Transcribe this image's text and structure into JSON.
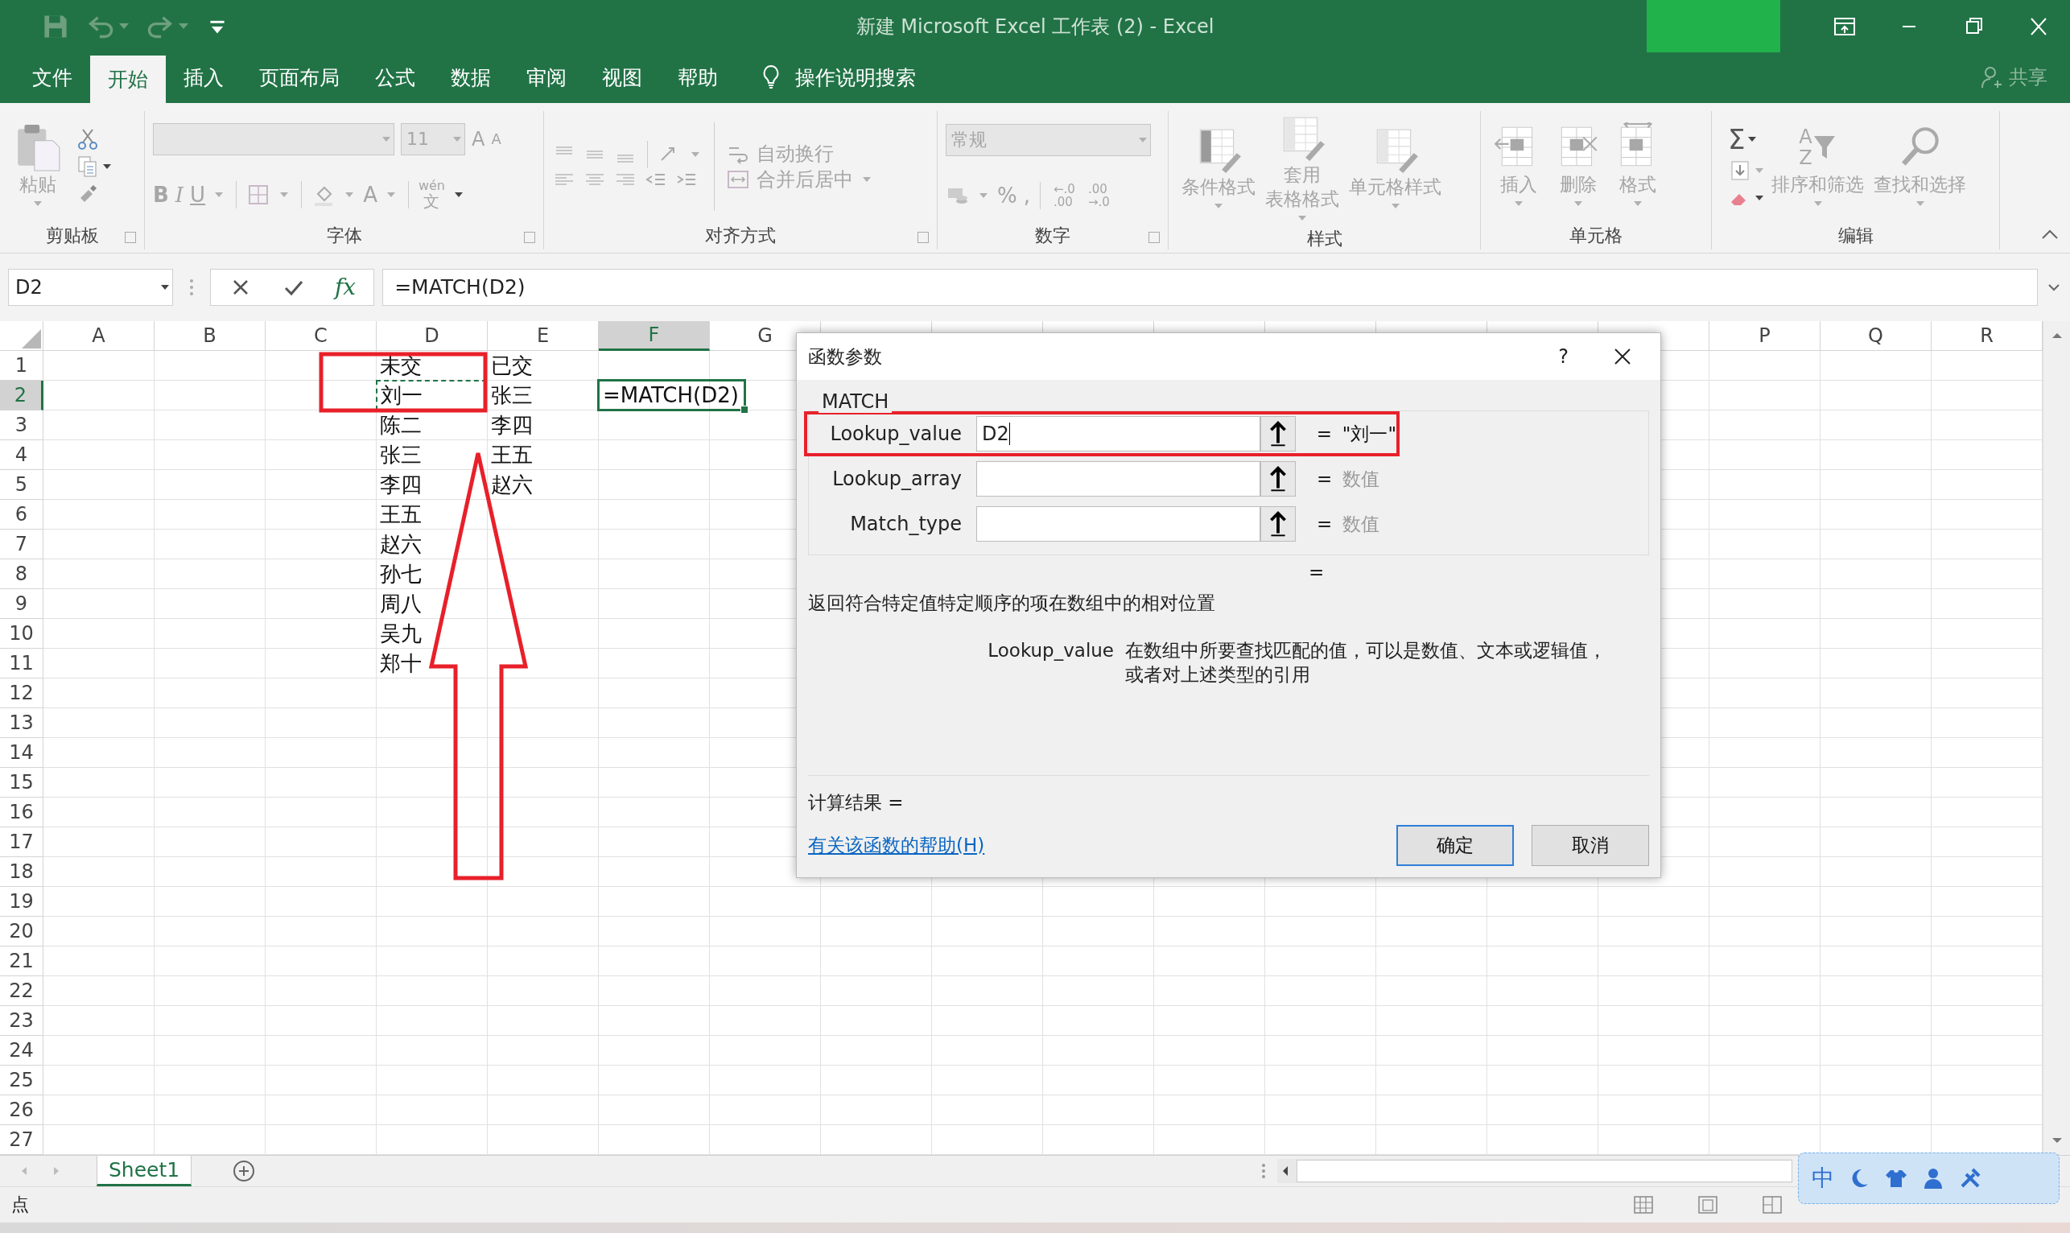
{
  "window": {
    "title": "新建 Microsoft Excel 工作表 (2)  -  Excel"
  },
  "ribbon_tabs": [
    {
      "label": "文件",
      "selected": false
    },
    {
      "label": "开始",
      "selected": true
    },
    {
      "label": "插入",
      "selected": false
    },
    {
      "label": "页面布局",
      "selected": false
    },
    {
      "label": "公式",
      "selected": false
    },
    {
      "label": "数据",
      "selected": false
    },
    {
      "label": "审阅",
      "selected": false
    },
    {
      "label": "视图",
      "selected": false
    },
    {
      "label": "帮助",
      "selected": false
    }
  ],
  "tell_me": "操作说明搜索",
  "share": "共享",
  "ribbon": {
    "disabled": true,
    "clipboard": {
      "label": "剪贴板",
      "paste": "粘贴"
    },
    "font": {
      "label": "字体",
      "size": "11",
      "grow": "A",
      "shrink": "A",
      "bold": "B",
      "italic": "I",
      "underline": "U",
      "font_color": "A",
      "phonetic_top": "wén",
      "phonetic_bottom": "文"
    },
    "alignment": {
      "label": "对齐方式",
      "wrap": "自动换行",
      "merge": "合并后居中"
    },
    "number": {
      "label": "数字",
      "format": "常规",
      "percent": "%",
      "comma": ",",
      "increase_decimal": [
        "←.0",
        ".00"
      ],
      "decrease_decimal": [
        ".00",
        "→.0"
      ]
    },
    "styles": {
      "label": "样式",
      "buttons": [
        {
          "lines": [
            "条件格式"
          ]
        },
        {
          "lines": [
            "套用",
            "表格格式"
          ]
        },
        {
          "lines": [
            "单元格样式"
          ]
        }
      ]
    },
    "cells": {
      "label": "单元格",
      "buttons": [
        "插入",
        "删除",
        "格式"
      ]
    },
    "editing": {
      "label": "编辑",
      "sum": "Σ",
      "sort_letters": [
        "A",
        "Z"
      ],
      "buttons": [
        "排序和筛选",
        "查找和选择"
      ]
    }
  },
  "formula_bar": {
    "name_box": "D2",
    "insert_function": "fx",
    "formula": "=MATCH(D2)"
  },
  "sheet": {
    "columns": [
      {
        "label": "A",
        "selected": false
      },
      {
        "label": "B",
        "selected": false
      },
      {
        "label": "C",
        "selected": false
      },
      {
        "label": "D",
        "selected": false
      },
      {
        "label": "E",
        "selected": false
      },
      {
        "label": "F",
        "selected": true
      },
      {
        "label": "G",
        "selected": false
      },
      null,
      null,
      null,
      null,
      null,
      null,
      null,
      null,
      {
        "label": "P",
        "selected": false
      },
      {
        "label": "Q",
        "selected": false
      },
      {
        "label": "R",
        "selected": false
      }
    ],
    "rows": [
      {
        "label": "1",
        "selected": false,
        "cells": [
          null,
          null,
          null,
          {
            "text": "未交",
            "reference": false,
            "active": false
          },
          {
            "text": "已交",
            "reference": false,
            "active": false
          }
        ]
      },
      {
        "label": "2",
        "selected": true,
        "cells": [
          null,
          null,
          null,
          {
            "text": "刘一",
            "reference": true,
            "active": false
          },
          {
            "text": "张三",
            "reference": false,
            "active": false
          },
          {
            "text": "=MATCH(D2)",
            "reference": false,
            "active": true
          }
        ]
      },
      {
        "label": "3",
        "selected": false,
        "cells": [
          null,
          null,
          null,
          {
            "text": "陈二",
            "reference": false,
            "active": false
          },
          {
            "text": "李四",
            "reference": false,
            "active": false
          }
        ]
      },
      {
        "label": "4",
        "selected": false,
        "cells": [
          null,
          null,
          null,
          {
            "text": "张三",
            "reference": false,
            "active": false
          },
          {
            "text": "王五",
            "reference": false,
            "active": false
          }
        ]
      },
      {
        "label": "5",
        "selected": false,
        "cells": [
          null,
          null,
          null,
          {
            "text": "李四",
            "reference": false,
            "active": false
          },
          {
            "text": "赵六",
            "reference": false,
            "active": false
          }
        ]
      },
      {
        "label": "6",
        "selected": false,
        "cells": [
          null,
          null,
          null,
          {
            "text": "王五",
            "reference": false,
            "active": false
          }
        ]
      },
      {
        "label": "7",
        "selected": false,
        "cells": [
          null,
          null,
          null,
          {
            "text": "赵六",
            "reference": false,
            "active": false
          }
        ]
      },
      {
        "label": "8",
        "selected": false,
        "cells": [
          null,
          null,
          null,
          {
            "text": "孙七",
            "reference": false,
            "active": false
          }
        ]
      },
      {
        "label": "9",
        "selected": false,
        "cells": [
          null,
          null,
          null,
          {
            "text": "周八",
            "reference": false,
            "active": false
          }
        ]
      },
      {
        "label": "10",
        "selected": false,
        "cells": [
          null,
          null,
          null,
          {
            "text": "吴九",
            "reference": false,
            "active": false
          }
        ]
      },
      {
        "label": "11",
        "selected": false,
        "cells": [
          null,
          null,
          null,
          {
            "text": "郑十",
            "reference": false,
            "active": false
          }
        ]
      },
      {
        "label": "12",
        "selected": false
      },
      {
        "label": "13",
        "selected": false
      },
      {
        "label": "14",
        "selected": false
      },
      {
        "label": "15",
        "selected": false
      },
      {
        "label": "16",
        "selected": false
      },
      {
        "label": "17",
        "selected": false
      },
      {
        "label": "18",
        "selected": false
      },
      {
        "label": "19",
        "selected": false
      },
      {
        "label": "20",
        "selected": false
      },
      {
        "label": "21",
        "selected": false
      },
      {
        "label": "22",
        "selected": false
      },
      {
        "label": "23",
        "selected": false
      },
      {
        "label": "24",
        "selected": false
      },
      {
        "label": "25",
        "selected": false
      },
      {
        "label": "26",
        "selected": false
      },
      {
        "label": "27",
        "selected": false
      }
    ]
  },
  "dialog": {
    "title": "函数参数",
    "help": "?",
    "function": "MATCH",
    "params": [
      {
        "name": "Lookup_value",
        "value": "D2",
        "equals": "=",
        "result": "\"刘一\"",
        "evaluated": true,
        "highlighted": true
      },
      {
        "name": "Lookup_array",
        "equals": "=",
        "result": "数值",
        "evaluated": false,
        "highlighted": false
      },
      {
        "name": "Match_type",
        "equals": "=",
        "result": "数值",
        "evaluated": false,
        "highlighted": false
      }
    ],
    "result_equals": "=",
    "description": "返回符合特定值特定顺序的项在数组中的相对位置",
    "arg_help": {
      "name": "Lookup_value",
      "lines": [
        "在数组中所要查找匹配的值，可以是数值、文本或逻辑值，",
        "或者对上述类型的引用"
      ]
    },
    "calc_result": "计算结果 =",
    "help_link": "有关该函数的帮助(H)",
    "buttons": [
      {
        "label": "确定",
        "default": true
      },
      {
        "label": "取消",
        "default": false
      }
    ]
  },
  "sheet_tabs": [
    {
      "label": "Sheet1",
      "selected": true
    }
  ],
  "status_bar": {
    "mode": "点"
  },
  "ime_bar": {
    "label": "中"
  }
}
